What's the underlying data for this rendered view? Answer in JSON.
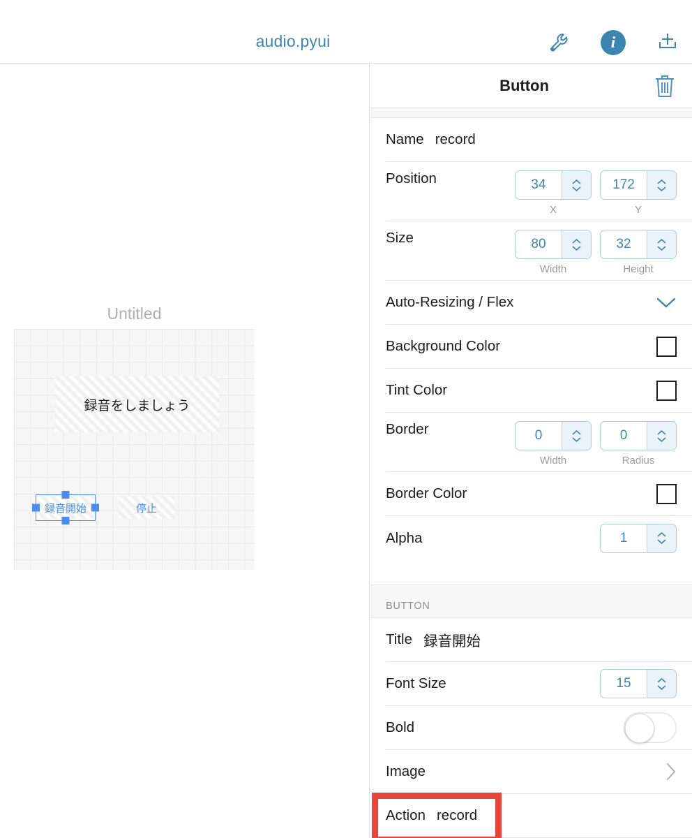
{
  "window": {
    "clipped_char": ")"
  },
  "topbar": {
    "document_title": "audio.pyui",
    "icons": [
      {
        "name": "wrench-icon",
        "label": "wrench"
      },
      {
        "name": "info-icon",
        "label": "i"
      },
      {
        "name": "add-to-tray-icon",
        "label": "add"
      }
    ]
  },
  "canvas": {
    "view_title": "Untitled",
    "widgets": [
      {
        "name": "label",
        "text": "録音をしましょう"
      },
      {
        "name": "record-button",
        "text": "録音開始",
        "selected": true
      },
      {
        "name": "stop-button",
        "text": "停止",
        "selected": false
      }
    ]
  },
  "inspector": {
    "title": "Button",
    "name_row": {
      "label": "Name",
      "value": "record"
    },
    "position_row": {
      "label": "Position",
      "x": {
        "value": "34",
        "sub": "X"
      },
      "y": {
        "value": "172",
        "sub": "Y"
      }
    },
    "size_row": {
      "label": "Size",
      "width": {
        "value": "80",
        "sub": "Width"
      },
      "height": {
        "value": "32",
        "sub": "Height"
      }
    },
    "autoresize_row": {
      "label": "Auto-Resizing / Flex"
    },
    "background_color_row": {
      "label": "Background Color",
      "swatch": "#ffffff"
    },
    "tint_color_row": {
      "label": "Tint Color",
      "swatch": "#ffffff"
    },
    "border_row": {
      "label": "Border",
      "width": {
        "value": "0",
        "sub": "Width"
      },
      "radius": {
        "value": "0",
        "sub": "Radius"
      }
    },
    "border_color_row": {
      "label": "Border Color",
      "swatch": "#ffffff"
    },
    "alpha_row": {
      "label": "Alpha",
      "value": "1"
    },
    "button_section": {
      "header": "BUTTON",
      "title_row": {
        "label": "Title",
        "value": "録音開始"
      },
      "font_size_row": {
        "label": "Font Size",
        "value": "15"
      },
      "bold_row": {
        "label": "Bold",
        "on": false
      },
      "image_row": {
        "label": "Image"
      },
      "action_row": {
        "label": "Action",
        "value": "record",
        "highlighted": true
      }
    }
  },
  "colors": {
    "accent_blue": "#3d85b0",
    "selection_blue": "#4a8cf0",
    "highlight_red": "#e8453c",
    "canvas_grid": "#e7e7e7"
  }
}
